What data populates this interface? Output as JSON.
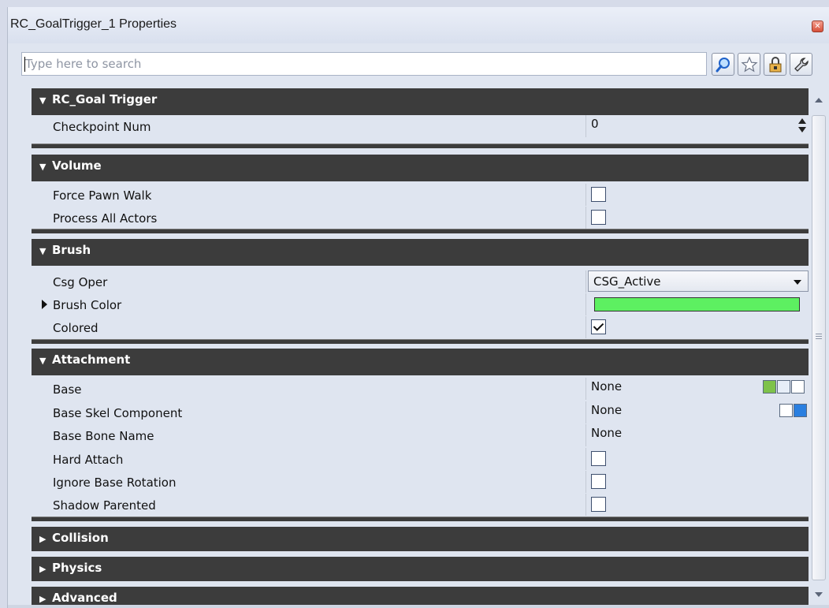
{
  "window": {
    "title": "RC_GoalTrigger_1 Properties"
  },
  "search": {
    "placeholder": "Type here to search",
    "value": ""
  },
  "toolbar": {
    "buttons": [
      {
        "icon": "magnifier-icon"
      },
      {
        "icon": "star-icon"
      },
      {
        "icon": "lock-icon"
      },
      {
        "icon": "wrench-icon"
      }
    ]
  },
  "categories": [
    {
      "label": "RC_Goal Trigger",
      "expanded": true,
      "rows": [
        {
          "label": "Checkpoint Num",
          "type": "number",
          "value": "0"
        }
      ]
    },
    {
      "label": "Volume",
      "expanded": true,
      "rows": [
        {
          "label": "Force Pawn Walk",
          "type": "checkbox",
          "checked": false
        },
        {
          "label": "Process All Actors",
          "type": "checkbox",
          "checked": false
        }
      ]
    },
    {
      "label": "Brush",
      "expanded": true,
      "rows": [
        {
          "label": "Csg Oper",
          "type": "select",
          "value": "CSG_Active"
        },
        {
          "label": "Brush Color",
          "type": "color",
          "color": "#5df061",
          "collapsible": true
        },
        {
          "label": "Colored",
          "type": "checkbox",
          "checked": true
        }
      ]
    },
    {
      "label": "Attachment",
      "expanded": true,
      "rows": [
        {
          "label": "Base",
          "type": "object",
          "value": "None"
        },
        {
          "label": "Base Skel Component",
          "type": "object",
          "value": "None"
        },
        {
          "label": "Base Bone Name",
          "type": "text",
          "value": "None"
        },
        {
          "label": "Hard Attach",
          "type": "checkbox",
          "checked": false
        },
        {
          "label": "Ignore Base Rotation",
          "type": "checkbox",
          "checked": false
        },
        {
          "label": "Shadow Parented",
          "type": "checkbox",
          "checked": false
        }
      ]
    },
    {
      "label": "Collision",
      "expanded": false
    },
    {
      "label": "Physics",
      "expanded": false
    },
    {
      "label": "Advanced",
      "expanded": false
    }
  ],
  "colors": {
    "category_bg": "#3c3c3c",
    "panel_bg": "#dfe5f0",
    "brush_color": "#5df061"
  }
}
